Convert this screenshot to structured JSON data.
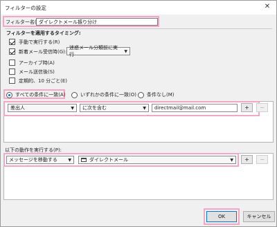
{
  "window": {
    "title": "フィルターの設定",
    "close_glyph": "✕"
  },
  "filter_name": {
    "label": "フィルター名(I):",
    "value": "ダイレクトメール振り分け"
  },
  "timing": {
    "group_label": "フィルターを適用するタイミング:",
    "manual_run": {
      "label": "手動で実行する(R)",
      "checked": true
    },
    "on_receive": {
      "label": "新着メール受信時(G):",
      "checked": true,
      "dropdown": "迷惑メール分類前に実行"
    },
    "archive": {
      "label": "アーカイブ時(A)",
      "checked": false
    },
    "after_send": {
      "label": "メール送信後(S)",
      "checked": false
    },
    "periodic": {
      "label": "定期的、10 分ごと(E)",
      "checked": false
    }
  },
  "match": {
    "all": "すべての条件に一致(A)",
    "any": "いずれかの条件に一致(O)",
    "none": "条件なし(M)",
    "selected": "all"
  },
  "condition": {
    "field": "差出人",
    "operator": "に次を含む",
    "value": "directmail@mail.com",
    "add": "+",
    "remove": "−"
  },
  "actions": {
    "label": "以下の動作を実行する(P):",
    "action": "メッセージを移動する",
    "folder": "ダイレクトメール",
    "add": "+",
    "remove": "−"
  },
  "buttons": {
    "ok": "OK",
    "cancel": "キャンセル"
  },
  "icons": {
    "dropdown": "chevron-down-icon",
    "folder": "folder-icon",
    "close": "close-icon"
  }
}
